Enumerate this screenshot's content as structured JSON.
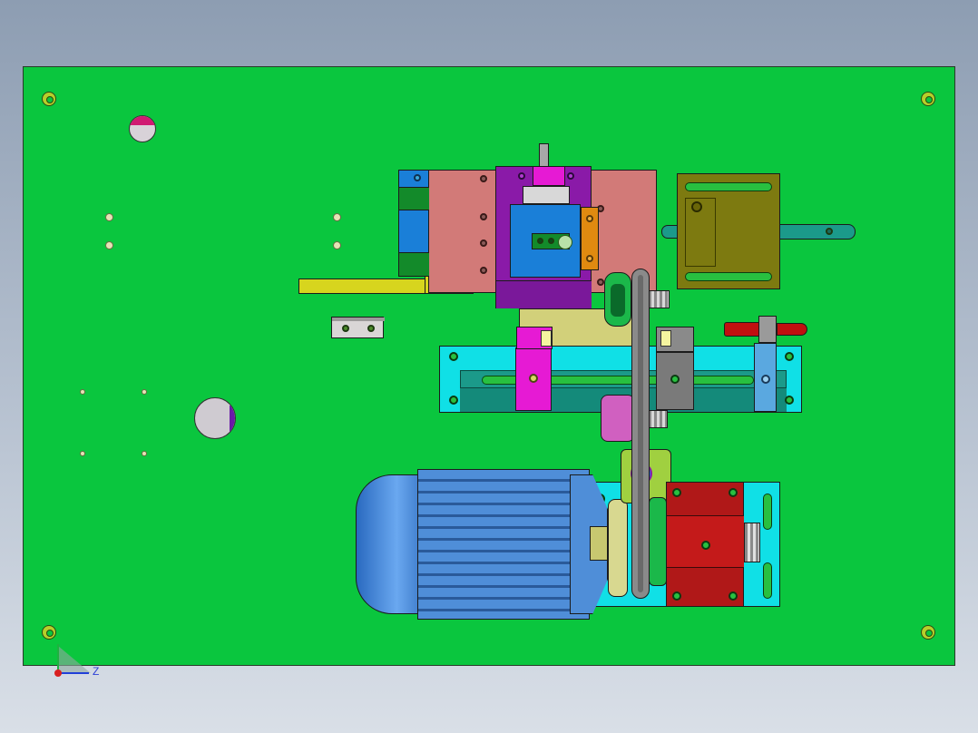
{
  "view": {
    "title": "",
    "background_colors": [
      "#8d9db2",
      "#d9dfe7"
    ],
    "plate_color": "#0ac63e"
  },
  "triad": {
    "axis_label": "Z",
    "colors": {
      "x": "#d82020",
      "y": "#20b040",
      "z": "#2040d8"
    }
  },
  "parts": {
    "motor": {
      "color": "#4f8ed8"
    },
    "belt": {
      "color": "#8a8a8a"
    },
    "gearbox": {
      "color": "#c41a1a"
    },
    "slide_rail": {
      "color": "#10e0e6"
    },
    "clamp_block": {
      "color": "#8a1aa8"
    },
    "mount_block": {
      "color": "#d27a78"
    },
    "bracket": {
      "color": "#7d7a10"
    },
    "slider_pink": {
      "color": "#e61ad4"
    },
    "red_rod": {
      "color": "#c01010"
    }
  }
}
